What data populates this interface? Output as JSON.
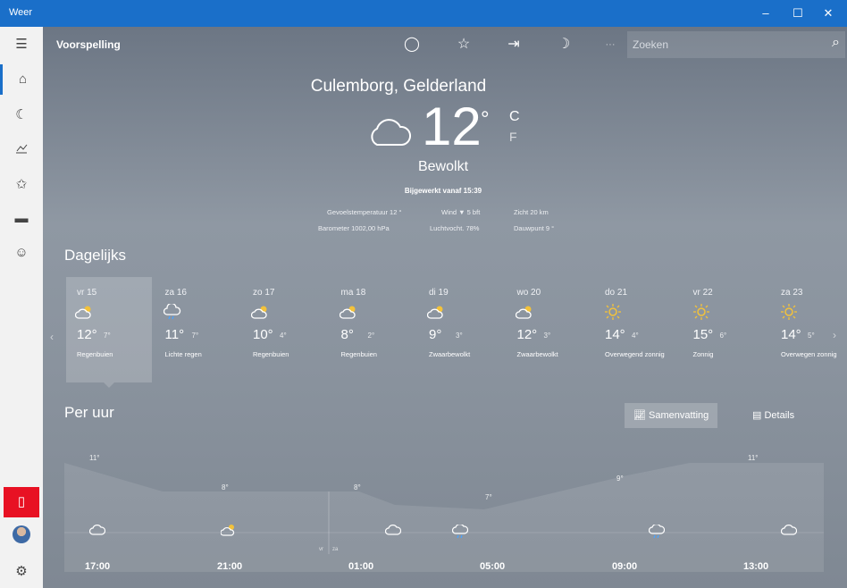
{
  "window": {
    "title": "Weer",
    "minimize": "–",
    "maximize": "☐",
    "close": "✕"
  },
  "rail": {
    "icons": [
      "hamburger-icon",
      "home-icon",
      "moon-forecast-icon",
      "chart-icon",
      "star-list-icon",
      "news-icon",
      "smiley-icon",
      "phone-icon",
      "avatar",
      "gear-icon"
    ]
  },
  "topbar": {
    "title": "Voorspelling",
    "refresh": "◯",
    "favorite": "☆",
    "pin": "⇥",
    "moon": "☽",
    "more": "···",
    "search_placeholder": "Zoeken",
    "search_icon": "⚲"
  },
  "current": {
    "location": "Culemborg, Gelderland",
    "temp": "12",
    "degree": "°",
    "unit_c": "C",
    "unit_f": "F",
    "condition": "Bewolkt",
    "updated": "Bijgewerkt vanaf 15:39",
    "stats": {
      "feels": "Gevoelstemperatuur  12 °",
      "wind": "Wind  ▼ 5 bft",
      "visibility": "Zicht  20 km",
      "barometer": "Barometer  1002,00 hPa",
      "humidity": "Luchtvocht.  78%",
      "dewpoint": "Dauwpunt  9 °"
    }
  },
  "daily": {
    "label": "Dagelijks",
    "days": [
      {
        "name": "vr 15",
        "hi": "12°",
        "lo": "7°",
        "desc": "Regenbuien",
        "icon": "partly-cloudy-icon"
      },
      {
        "name": "za 16",
        "hi": "11°",
        "lo": "7°",
        "desc": "Lichte regen",
        "icon": "rain-icon"
      },
      {
        "name": "zo 17",
        "hi": "10°",
        "lo": "4°",
        "desc": "Regenbuien",
        "icon": "partly-cloudy-icon"
      },
      {
        "name": "ma 18",
        "hi": "8°",
        "lo": "2°",
        "desc": "Regenbuien",
        "icon": "partly-cloudy-icon"
      },
      {
        "name": "di 19",
        "hi": "9°",
        "lo": "3°",
        "desc": "Zwaarbewolkt",
        "icon": "partly-cloudy-icon"
      },
      {
        "name": "wo 20",
        "hi": "12°",
        "lo": "3°",
        "desc": "Zwaarbewolkt",
        "icon": "partly-cloudy-icon"
      },
      {
        "name": "do 21",
        "hi": "14°",
        "lo": "4°",
        "desc": "Overwegend zonnig",
        "icon": "sun-icon"
      },
      {
        "name": "vr 22",
        "hi": "15°",
        "lo": "6°",
        "desc": "Zonnig",
        "icon": "sun-icon"
      },
      {
        "name": "za 23",
        "hi": "14°",
        "lo": "5°",
        "desc": "Overwegen zonnig",
        "icon": "sun-icon"
      }
    ]
  },
  "hourly": {
    "label": "Per uur",
    "summary_btn": "Samenvatting",
    "details_btn": "Details",
    "temps": [
      "11°",
      "8°",
      "8°",
      "7°",
      "9°",
      "11°"
    ],
    "day_split_left": "vr",
    "day_split_right": "za",
    "times": [
      "17:00",
      "21:00",
      "01:00",
      "05:00",
      "09:00",
      "13:00"
    ]
  }
}
